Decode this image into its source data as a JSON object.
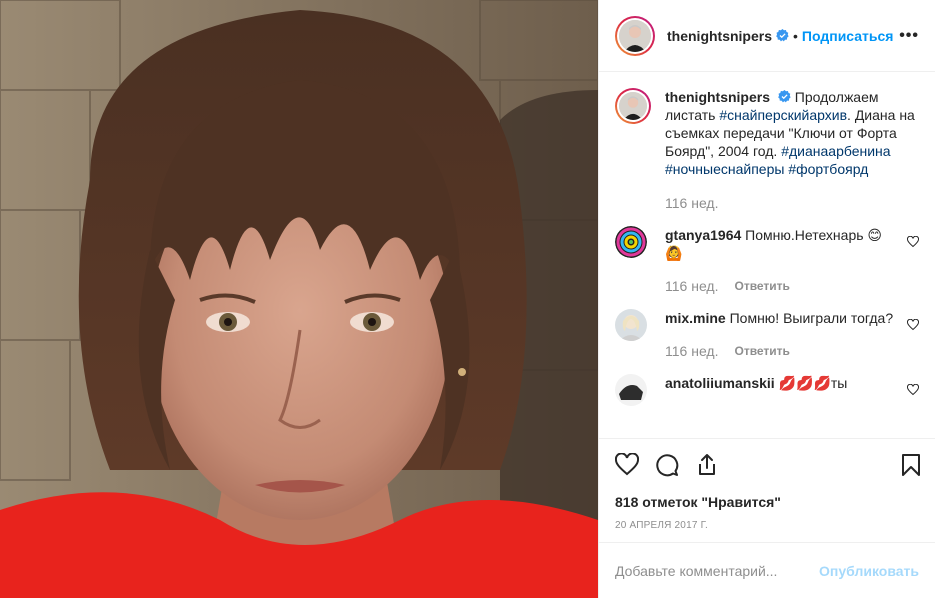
{
  "post": {
    "author": "thenightsnipers",
    "follow_label": "Подписаться",
    "dot": "•",
    "more": "•••",
    "caption": {
      "text_1": "Продолжаем листать ",
      "tag_1": "#снайперскийархив",
      "text_2": ". Диана на съемках передачи \"Ключи от Форта Боярд\", 2004 год.",
      "tag_2": "#дианаарбенина",
      "tag_3": "#ночныеснайперы",
      "tag_4": "#фортбоярд",
      "time": "116 нед."
    },
    "comments": [
      {
        "user": "gtanya1964",
        "text": "Помню.Нетехнарь 😊🙆",
        "time": "116 нед.",
        "reply": "Ответить"
      },
      {
        "user": "mix.mine",
        "text": "Помню! Выиграли тогда?",
        "time": "116 нед.",
        "reply": "Ответить"
      },
      {
        "user": "anatoliiumanskii",
        "text": "💋💋💋ты"
      }
    ],
    "likes": "818 отметок \"Нравится\"",
    "date": "20 АПРЕЛЯ 2017 Г.",
    "comment_placeholder": "Добавьте комментарий...",
    "publish_label": "Опубликовать"
  },
  "icons": {
    "like": "heart-icon",
    "comment": "comment-icon",
    "share": "share-icon",
    "save": "bookmark-icon",
    "verified": "verified-badge-icon",
    "more": "more-options-icon"
  },
  "colors": {
    "accent": "#0095f6",
    "hashtag": "#00376b",
    "muted": "#8e8e8e",
    "text": "#262626"
  }
}
